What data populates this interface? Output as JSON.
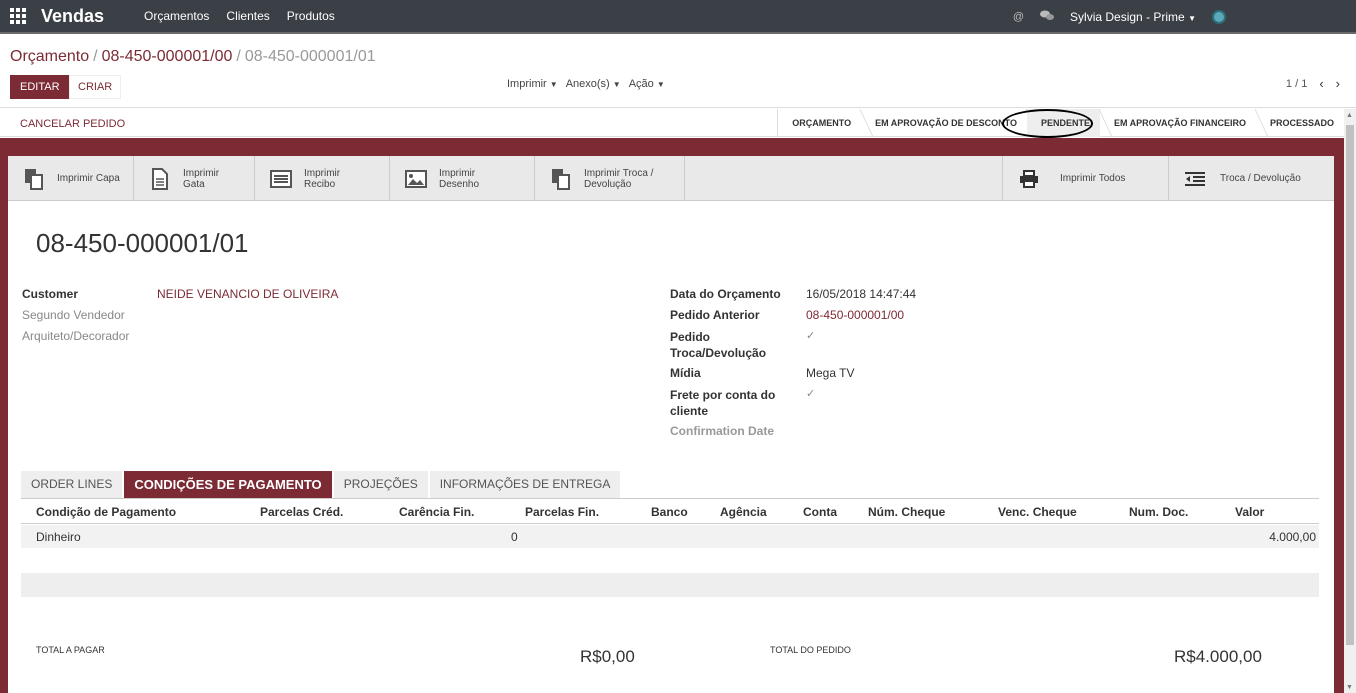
{
  "navbar": {
    "brand": "Vendas",
    "menu": [
      "Orçamentos",
      "Clientes",
      "Produtos"
    ],
    "user": "Sylvia Design - Prime"
  },
  "breadcrumb": {
    "root": "Orçamento",
    "sep": "/",
    "parent": "08-450-000001/00",
    "current": "08-450-000001/01"
  },
  "buttons": {
    "edit": "EDITAR",
    "create": "CRIAR"
  },
  "actions": {
    "print": "Imprimir",
    "attach": "Anexo(s)",
    "action": "Ação"
  },
  "pager": {
    "value": "1 / 1"
  },
  "status": {
    "cancel": "CANCELAR PEDIDO",
    "stages": [
      "ORÇAMENTO",
      "EM APROVAÇÃO DE DESCONTO",
      "PENDENTE",
      "EM APROVAÇÃO FINANCEIRO",
      "PROCESSADO"
    ],
    "current": "PENDENTE"
  },
  "buttonbox": [
    {
      "icon": "copy-icon",
      "label1": "Imprimir Capa",
      "label2": ""
    },
    {
      "icon": "file-text-icon",
      "label1": "Imprimir",
      "label2": "Gata"
    },
    {
      "icon": "list-alt-icon",
      "label1": "Imprimir",
      "label2": "Recibo"
    },
    {
      "icon": "picture-icon",
      "label1": "Imprimir",
      "label2": "Desenho"
    },
    {
      "icon": "copy-icon",
      "label1": "Imprimir Troca /",
      "label2": "Devolução"
    },
    {
      "icon": "print-icon",
      "label1": "Imprimir Todos",
      "label2": ""
    },
    {
      "icon": "outdent-icon",
      "label1": "Troca / Devolução",
      "label2": ""
    }
  ],
  "record": {
    "title": "08-450-000001/01"
  },
  "left_fields": {
    "customer_label": "Customer",
    "customer_value": "NEIDE VENANCIO DE OLIVEIRA",
    "seller_label": "Segundo Vendedor",
    "architect_label": "Arquiteto/Decorador"
  },
  "right_fields": {
    "date_label": "Data do Orçamento",
    "date_value": "16/05/2018 14:47:44",
    "prev_label": "Pedido Anterior",
    "prev_value": "08-450-000001/00",
    "exchange_label_1": "Pedido",
    "exchange_label_2": "Troca/Devolução",
    "media_label": "Mídia",
    "media_value": "Mega TV",
    "freight_label_1": "Frete por conta do",
    "freight_label_2": "cliente",
    "confirm_label": "Confirmation Date"
  },
  "tabs": [
    "ORDER LINES",
    "CONDIÇÕES DE PAGAMENTO",
    "PROJEÇÕES",
    "INFORMAÇÕES DE ENTREGA"
  ],
  "table": {
    "columns": [
      "Condição de Pagamento",
      "Parcelas Créd.",
      "Carência Fin.",
      "Parcelas Fin.",
      "Banco",
      "Agência",
      "Conta",
      "Núm. Cheque",
      "Venc. Cheque",
      "Num. Doc.",
      "Valor"
    ],
    "rows": [
      {
        "condicao": "Dinheiro",
        "carencia": "0",
        "valor": "4.000,00"
      }
    ]
  },
  "totals": {
    "pay_label": "TOTAL A PAGAR",
    "pay_value": "R$0,00",
    "order_label": "TOTAL DO PEDIDO",
    "order_value": "R$4.000,00"
  },
  "colors": {
    "brand": "#7c2b35",
    "navbar": "#3b3f46"
  }
}
